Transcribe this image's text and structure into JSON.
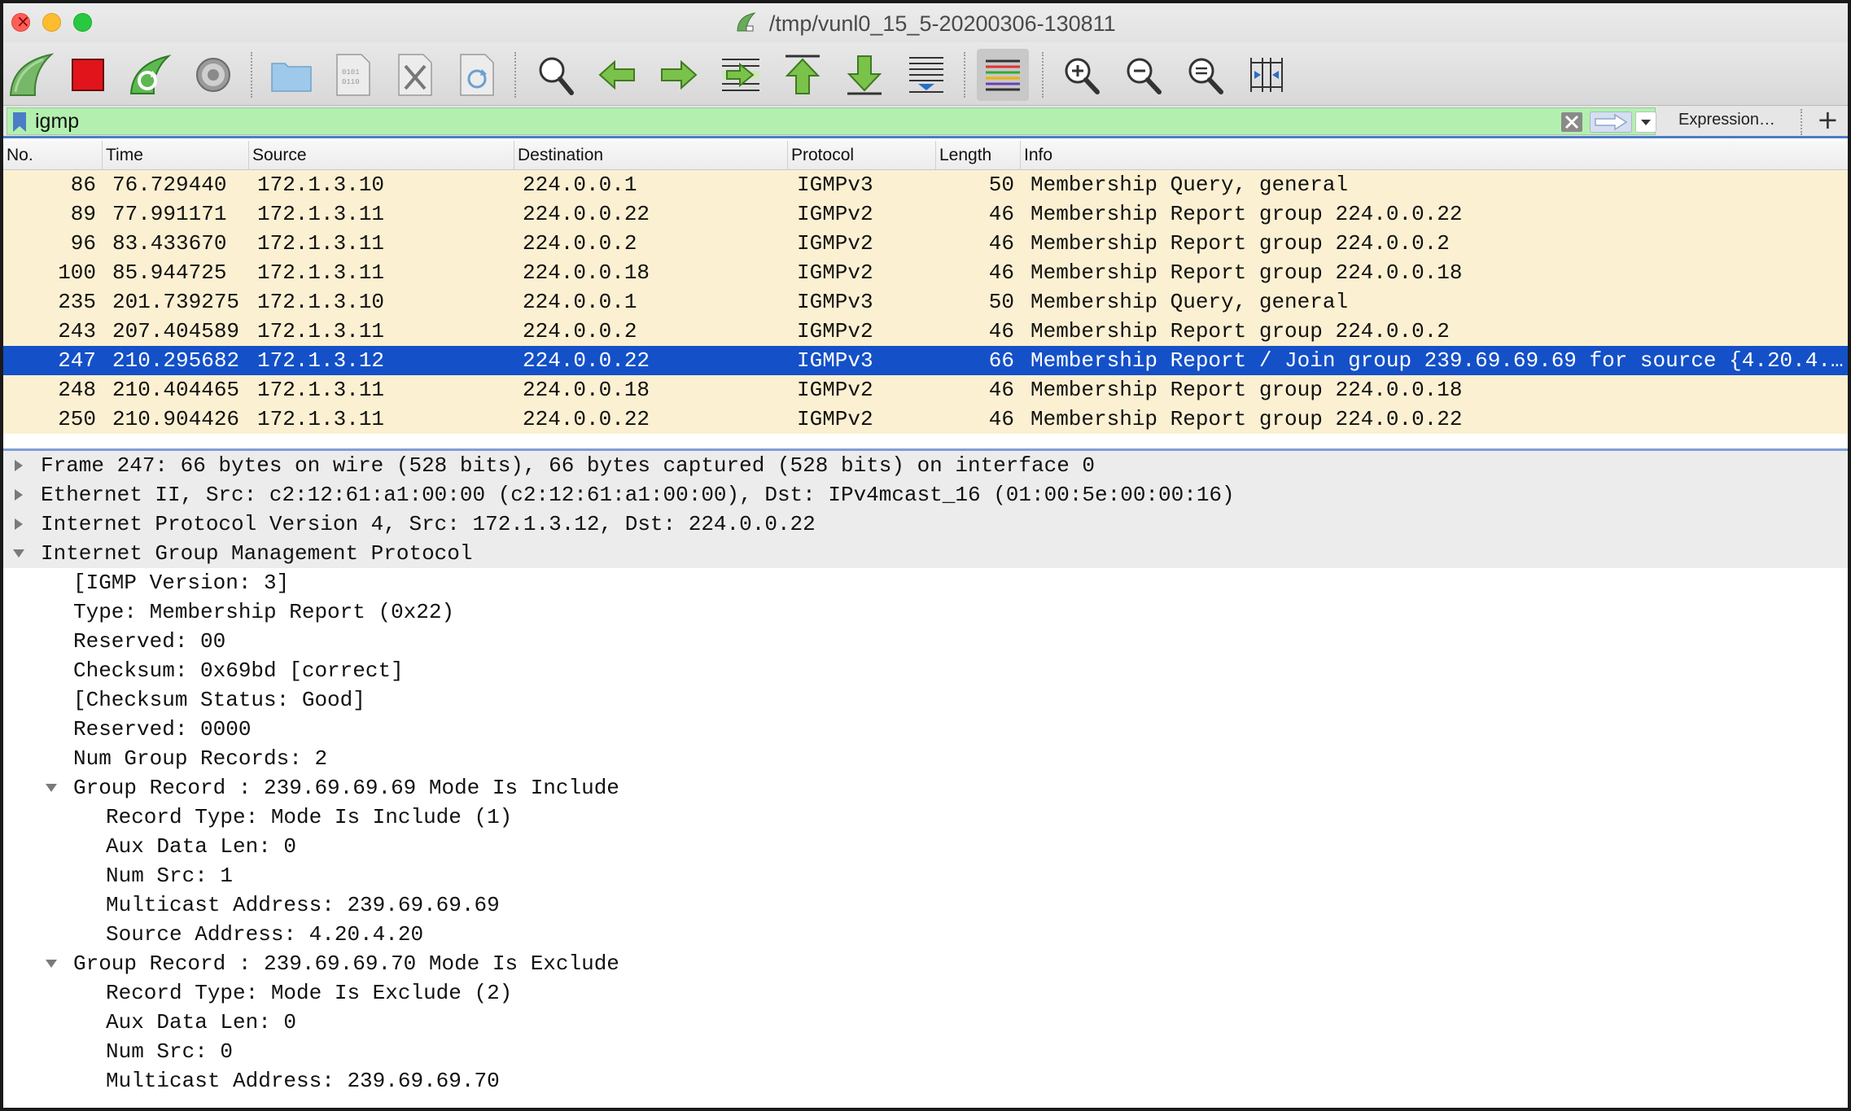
{
  "window": {
    "title": "/tmp/vunl0_15_5-20200306-130811"
  },
  "toolbar": {
    "buttons": [
      "start-capture",
      "stop-capture",
      "restart-capture",
      "capture-options",
      "open-file",
      "save-file",
      "close-file",
      "reload-file",
      "find-packet",
      "go-back",
      "go-forward",
      "go-to-packet",
      "go-first",
      "go-last",
      "autoscroll",
      "colorize",
      "zoom-in",
      "zoom-out",
      "zoom-normal",
      "resize-columns"
    ]
  },
  "filter": {
    "value": "igmp",
    "expression_label": "Expression…",
    "plus_label": "+"
  },
  "packet_list": {
    "columns": [
      "No.",
      "Time",
      "Source",
      "Destination",
      "Protocol",
      "Length",
      "Info"
    ],
    "rows": [
      {
        "no": "86",
        "time": "76.729440",
        "source": "172.1.3.10",
        "destination": "224.0.0.1",
        "protocol": "IGMPv3",
        "length": "50",
        "info": "Membership Query, general"
      },
      {
        "no": "89",
        "time": "77.991171",
        "source": "172.1.3.11",
        "destination": "224.0.0.22",
        "protocol": "IGMPv2",
        "length": "46",
        "info": "Membership Report group 224.0.0.22"
      },
      {
        "no": "96",
        "time": "83.433670",
        "source": "172.1.3.11",
        "destination": "224.0.0.2",
        "protocol": "IGMPv2",
        "length": "46",
        "info": "Membership Report group 224.0.0.2"
      },
      {
        "no": "100",
        "time": "85.944725",
        "source": "172.1.3.11",
        "destination": "224.0.0.18",
        "protocol": "IGMPv2",
        "length": "46",
        "info": "Membership Report group 224.0.0.18"
      },
      {
        "no": "235",
        "time": "201.739275",
        "source": "172.1.3.10",
        "destination": "224.0.0.1",
        "protocol": "IGMPv3",
        "length": "50",
        "info": "Membership Query, general"
      },
      {
        "no": "243",
        "time": "207.404589",
        "source": "172.1.3.11",
        "destination": "224.0.0.2",
        "protocol": "IGMPv2",
        "length": "46",
        "info": "Membership Report group 224.0.0.2"
      },
      {
        "no": "247",
        "time": "210.295682",
        "source": "172.1.3.12",
        "destination": "224.0.0.22",
        "protocol": "IGMPv3",
        "length": "66",
        "info": "Membership Report / Join group 239.69.69.69 for source {4.20.4.…"
      },
      {
        "no": "248",
        "time": "210.404465",
        "source": "172.1.3.11",
        "destination": "224.0.0.18",
        "protocol": "IGMPv2",
        "length": "46",
        "info": "Membership Report group 224.0.0.18"
      },
      {
        "no": "250",
        "time": "210.904426",
        "source": "172.1.3.11",
        "destination": "224.0.0.22",
        "protocol": "IGMPv2",
        "length": "46",
        "info": "Membership Report group 224.0.0.22"
      }
    ],
    "selected_no": "247"
  },
  "details": [
    {
      "text": "Frame 247: 66 bytes on wire (528 bits), 66 bytes captured (528 bits) on interface 0",
      "level": 0,
      "expander": "collapsed"
    },
    {
      "text": "Ethernet II, Src: c2:12:61:a1:00:00 (c2:12:61:a1:00:00), Dst: IPv4mcast_16 (01:00:5e:00:00:16)",
      "level": 0,
      "expander": "collapsed"
    },
    {
      "text": "Internet Protocol Version 4, Src: 172.1.3.12, Dst: 224.0.0.22",
      "level": 0,
      "expander": "collapsed"
    },
    {
      "text": "Internet Group Management Protocol",
      "level": 0,
      "expander": "expanded"
    },
    {
      "text": "[IGMP Version: 3]",
      "level": 1,
      "expander": "none"
    },
    {
      "text": "Type: Membership Report (0x22)",
      "level": 1,
      "expander": "none"
    },
    {
      "text": "Reserved: 00",
      "level": 1,
      "expander": "none"
    },
    {
      "text": "Checksum: 0x69bd [correct]",
      "level": 1,
      "expander": "none"
    },
    {
      "text": "[Checksum Status: Good]",
      "level": 1,
      "expander": "none"
    },
    {
      "text": "Reserved: 0000",
      "level": 1,
      "expander": "none"
    },
    {
      "text": "Num Group Records: 2",
      "level": 1,
      "expander": "none"
    },
    {
      "text": "Group Record : 239.69.69.69  Mode Is Include",
      "level": 1,
      "expander": "expanded"
    },
    {
      "text": "Record Type: Mode Is Include (1)",
      "level": 2,
      "expander": "none"
    },
    {
      "text": "Aux Data Len: 0",
      "level": 2,
      "expander": "none"
    },
    {
      "text": "Num Src: 1",
      "level": 2,
      "expander": "none"
    },
    {
      "text": "Multicast Address: 239.69.69.69",
      "level": 2,
      "expander": "none"
    },
    {
      "text": "Source Address: 4.20.4.20",
      "level": 2,
      "expander": "none"
    },
    {
      "text": "Group Record : 239.69.69.70  Mode Is Exclude",
      "level": 1,
      "expander": "expanded"
    },
    {
      "text": "Record Type: Mode Is Exclude (2)",
      "level": 2,
      "expander": "none"
    },
    {
      "text": "Aux Data Len: 0",
      "level": 2,
      "expander": "none"
    },
    {
      "text": "Num Src: 0",
      "level": 2,
      "expander": "none"
    },
    {
      "text": "Multicast Address: 239.69.69.70",
      "level": 2,
      "expander": "none"
    }
  ],
  "colors": {
    "row_background": "#fcf0d2",
    "selected_row": "#1450c8",
    "filter_valid": "#b3f0b0"
  }
}
